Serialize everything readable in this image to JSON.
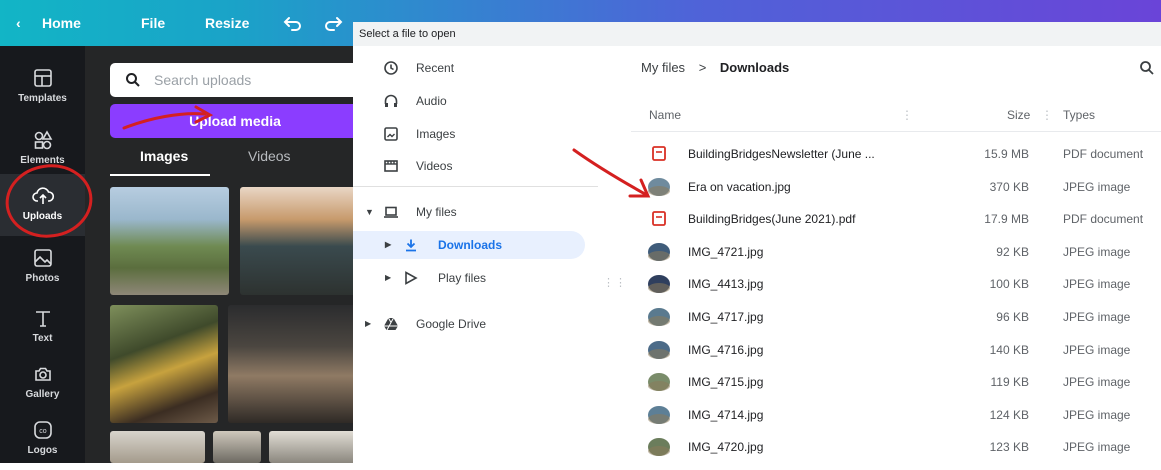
{
  "topbar": {
    "home": "Home",
    "file": "File",
    "resize": "Resize"
  },
  "rail": [
    {
      "label": "Templates",
      "icon": "templates-icon"
    },
    {
      "label": "Elements",
      "icon": "elements-icon"
    },
    {
      "label": "Uploads",
      "icon": "uploads-icon"
    },
    {
      "label": "Photos",
      "icon": "photos-icon"
    },
    {
      "label": "Text",
      "icon": "text-icon"
    },
    {
      "label": "Gallery",
      "icon": "gallery-icon"
    },
    {
      "label": "Logos",
      "icon": "logos-icon"
    }
  ],
  "panel": {
    "search_placeholder": "Search uploads",
    "upload_label": "Upload media",
    "tabs": [
      "Images",
      "Videos"
    ]
  },
  "dialog": {
    "title": "Select a file to open",
    "nav": [
      {
        "label": "Recent",
        "icon": "clock-icon"
      },
      {
        "label": "Audio",
        "icon": "headphones-icon"
      },
      {
        "label": "Images",
        "icon": "image-icon"
      },
      {
        "label": "Videos",
        "icon": "film-icon"
      },
      {
        "label": "My files",
        "icon": "laptop-icon"
      },
      {
        "label": "Downloads",
        "icon": "download-icon"
      },
      {
        "label": "Play files",
        "icon": "play-icon"
      },
      {
        "label": "Google Drive",
        "icon": "drive-icon"
      }
    ],
    "breadcrumb": {
      "root": "My files",
      "sep": ">",
      "current": "Downloads"
    },
    "columns": {
      "name": "Name",
      "size": "Size",
      "types": "Types"
    },
    "files": [
      {
        "name": "BuildingBridgesNewsletter (June ...",
        "size": "15.9 MB",
        "type": "PDF document",
        "kind": "pdf"
      },
      {
        "name": "Era on vacation.jpg",
        "size": "370 KB",
        "type": "JPEG image",
        "kind": "img"
      },
      {
        "name": "BuildingBridges(June 2021).pdf",
        "size": "17.9 MB",
        "type": "PDF document",
        "kind": "pdf"
      },
      {
        "name": "IMG_4721.jpg",
        "size": "92 KB",
        "type": "JPEG image",
        "kind": "img"
      },
      {
        "name": "IMG_4413.jpg",
        "size": "100 KB",
        "type": "JPEG image",
        "kind": "img"
      },
      {
        "name": "IMG_4717.jpg",
        "size": "96 KB",
        "type": "JPEG image",
        "kind": "img"
      },
      {
        "name": "IMG_4716.jpg",
        "size": "140 KB",
        "type": "JPEG image",
        "kind": "img"
      },
      {
        "name": "IMG_4715.jpg",
        "size": "119 KB",
        "type": "JPEG image",
        "kind": "img"
      },
      {
        "name": "IMG_4714.jpg",
        "size": "124 KB",
        "type": "JPEG image",
        "kind": "img"
      },
      {
        "name": "IMG_4720.jpg",
        "size": "123 KB",
        "type": "JPEG image",
        "kind": "img"
      }
    ]
  },
  "colors": {
    "accent": "#8b3dff",
    "rail": "#17191d",
    "panel": "#252627",
    "annotation": "#d42020",
    "pdf": "#d93025",
    "selected": "#e8f0fe"
  }
}
